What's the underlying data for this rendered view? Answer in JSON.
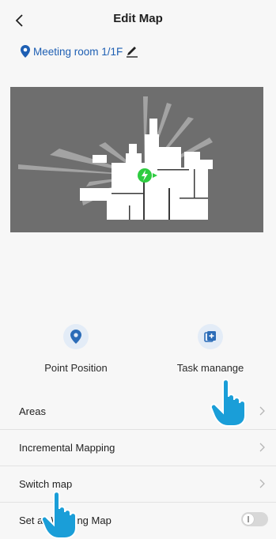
{
  "header": {
    "title": "Edit Map"
  },
  "location": {
    "name": "Meeting room 1/1F"
  },
  "actions": [
    {
      "label": "Point Position",
      "icon": "location-pin-icon"
    },
    {
      "label": "Task manange",
      "icon": "add-task-icon"
    }
  ],
  "list": [
    {
      "label": "Areas"
    },
    {
      "label": "Incremental Mapping"
    },
    {
      "label": "Switch map"
    },
    {
      "label": "Set as Working Map",
      "toggle": false
    }
  ],
  "colors": {
    "accent": "#1e5fb3",
    "map_bg": "#6e6e6e",
    "robot": "#2ecc40",
    "hand": "#1a9ed8"
  }
}
